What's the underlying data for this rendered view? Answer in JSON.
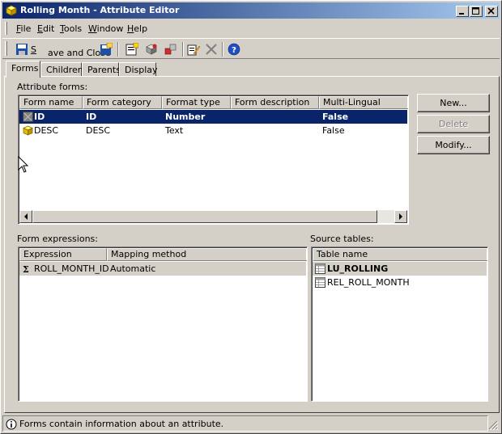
{
  "window": {
    "title": "Rolling Month - Attribute Editor",
    "icon": "cube-icon"
  },
  "menu": [
    {
      "label": "File",
      "key": "F",
      "rest": "ile"
    },
    {
      "label": "Edit",
      "key": "E",
      "rest": "dit"
    },
    {
      "label": "Tools",
      "key": "T",
      "rest": "ools"
    },
    {
      "label": "Window",
      "key": "W",
      "rest": "indow"
    },
    {
      "label": "Help",
      "key": "H",
      "rest": "elp"
    }
  ],
  "toolbar": {
    "save_close_label": "Save and Close",
    "save_close_key": "S",
    "save_close_rest": "ave and Close"
  },
  "tabs": [
    {
      "label": "Forms",
      "active": true
    },
    {
      "label": "Children",
      "active": false
    },
    {
      "label": "Parents",
      "active": false
    },
    {
      "label": "Display",
      "active": false
    }
  ],
  "attribute_forms": {
    "label": "Attribute forms:",
    "columns": [
      "Form name",
      "Form category",
      "Format type",
      "Form description",
      "Multi-Lingual"
    ],
    "rows": [
      {
        "name": "ID",
        "category": "ID",
        "format": "Number",
        "description": "",
        "multilingual": "False",
        "selected": true
      },
      {
        "name": "DESC",
        "category": "DESC",
        "format": "Text",
        "description": "",
        "multilingual": "False",
        "selected": false
      }
    ]
  },
  "buttons": {
    "new": "New...",
    "delete": "Delete",
    "modify": "Modify..."
  },
  "form_expressions": {
    "label": "Form expressions:",
    "columns": [
      "Expression",
      "Mapping method"
    ],
    "rows": [
      {
        "expression": "ROLL_MONTH_ID",
        "mapping": "Automatic"
      }
    ]
  },
  "source_tables": {
    "label": "Source tables:",
    "columns": [
      "Table name"
    ],
    "rows": [
      {
        "name": "LU_ROLLING",
        "bold": true
      },
      {
        "name": "REL_ROLL_MONTH",
        "bold": false
      }
    ]
  },
  "status": {
    "text": "Forms contain information about an attribute."
  },
  "colors": {
    "selection": "#0a246a",
    "face": "#d4d0c8"
  }
}
